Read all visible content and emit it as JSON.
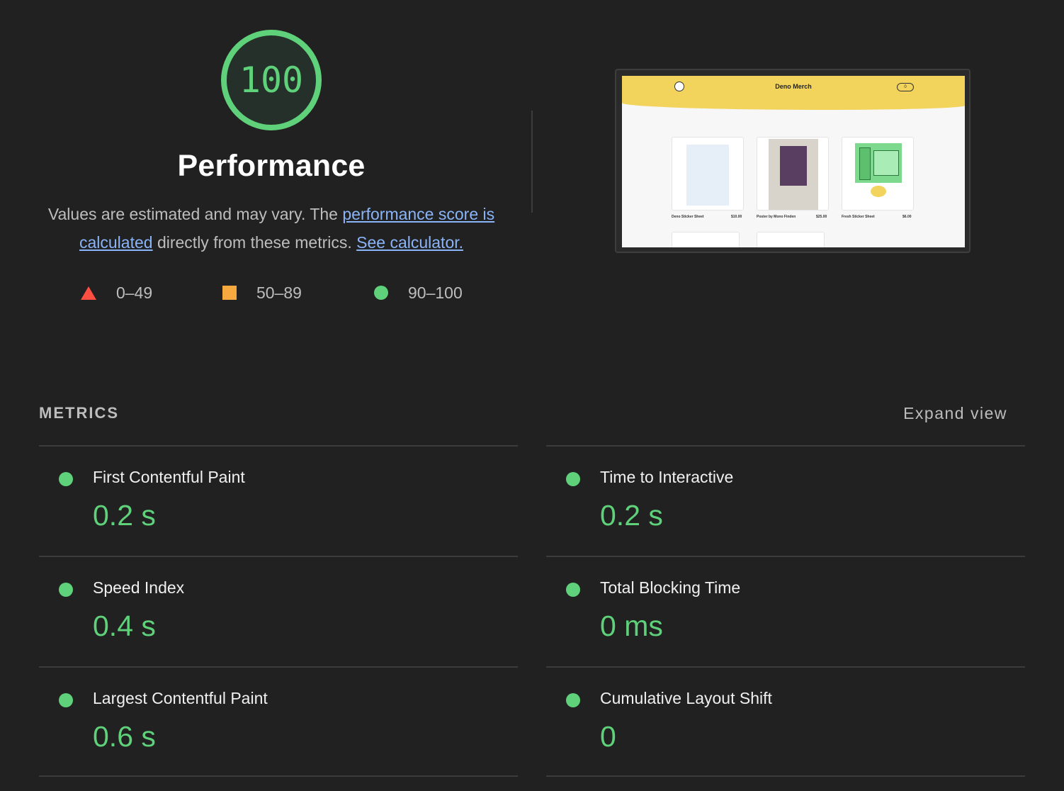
{
  "score": {
    "value": 100,
    "title": "Performance",
    "color": "#5fd17a"
  },
  "description": {
    "before": "Values are estimated and may vary. The ",
    "link1": "performance score is calculated",
    "middle": " directly from these metrics. ",
    "link2": "See calculator."
  },
  "legend": [
    {
      "shape": "triangle",
      "range": "0–49",
      "color": "#ff4e42"
    },
    {
      "shape": "square",
      "range": "50–89",
      "color": "#f5a93f"
    },
    {
      "shape": "circle",
      "range": "90–100",
      "color": "#5fd17a"
    }
  ],
  "thumbnail": {
    "site_title": "Deno Merch",
    "cart": "0",
    "products": [
      {
        "name": "Deno Sticker Sheet",
        "price": "$10.00"
      },
      {
        "name": "Poster by Mono Finden",
        "price": "$25.00"
      },
      {
        "name": "Fresh Sticker Sheet",
        "price": "$6.00"
      }
    ]
  },
  "metrics": {
    "header": "METRICS",
    "expand_label": "Expand view",
    "items": [
      {
        "title": "First Contentful Paint",
        "value": "0.2 s"
      },
      {
        "title": "Time to Interactive",
        "value": "0.2 s"
      },
      {
        "title": "Speed Index",
        "value": "0.4 s"
      },
      {
        "title": "Total Blocking Time",
        "value": "0 ms"
      },
      {
        "title": "Largest Contentful Paint",
        "value": "0.6 s"
      },
      {
        "title": "Cumulative Layout Shift",
        "value": "0"
      }
    ]
  }
}
